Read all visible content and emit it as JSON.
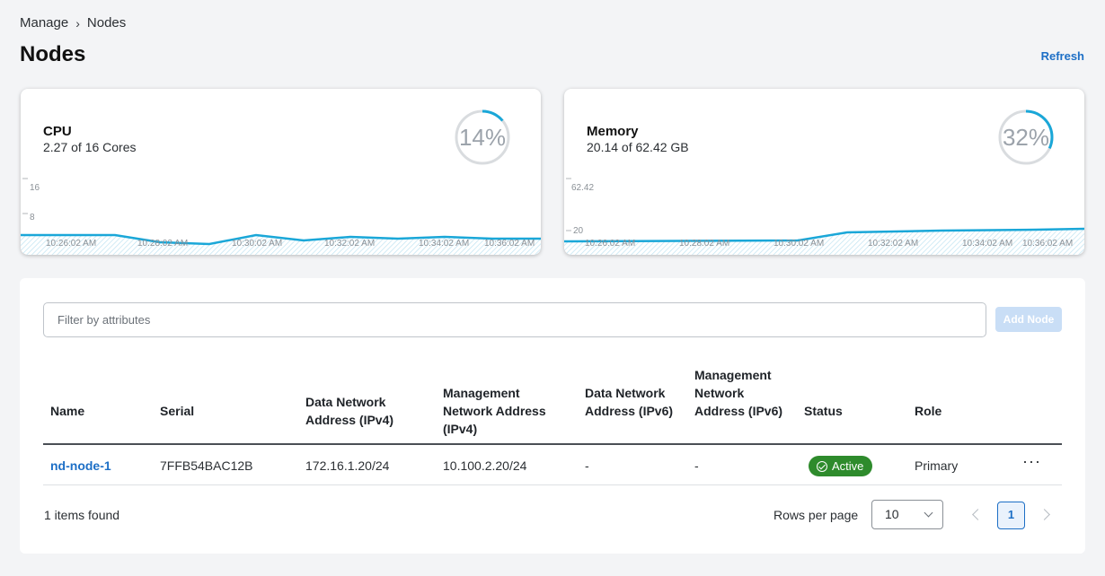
{
  "breadcrumb": {
    "root": "Manage",
    "separator": "›",
    "current": "Nodes"
  },
  "page": {
    "title": "Nodes",
    "refresh_label": "Refresh"
  },
  "cpu": {
    "title": "CPU",
    "summary": "2.27 of 16 Cores",
    "percent_label": "14%",
    "percent": 14,
    "y_ticks": [
      "16",
      "8"
    ],
    "x_ticks": [
      "10:26:02 AM",
      "10:28:02 AM",
      "10:30:02 AM",
      "10:32:02 AM",
      "10:34:02 AM",
      "10:36:02 AM"
    ]
  },
  "memory": {
    "title": "Memory",
    "summary": "20.14 of 62.42 GB",
    "percent_label": "32%",
    "percent": 32,
    "y_ticks": [
      "62.42",
      "20"
    ],
    "x_ticks": [
      "10:26:02 AM",
      "10:28:02 AM",
      "10:30:02 AM",
      "10:32:02 AM",
      "10:34:02 AM",
      "10:36:02 AM"
    ]
  },
  "table": {
    "filter_placeholder": "Filter by attributes",
    "add_node_label": "Add Node",
    "columns": [
      "Name",
      "Serial",
      "Data Network Address (IPv4)",
      "Management Network Address (IPv4)",
      "Data Network Address (IPv6)",
      "Management Network Address (IPv6)",
      "Status",
      "Role"
    ],
    "rows": [
      {
        "name": "nd-node-1",
        "serial": "7FFB54BAC12B",
        "data_ipv4": "172.16.1.20/24",
        "mgmt_ipv4": "10.100.2.20/24",
        "data_ipv6": "-",
        "mgmt_ipv6": "-",
        "status": "Active",
        "role": "Primary",
        "actions": "···"
      }
    ],
    "items_found": "1 items found",
    "rows_per_page_label": "Rows per page",
    "rows_per_page_value": "10",
    "current_page": "1"
  },
  "colors": {
    "accent": "#1d6fc6",
    "chart_line": "#1aa7d8",
    "status_active": "#2e8b2c"
  }
}
